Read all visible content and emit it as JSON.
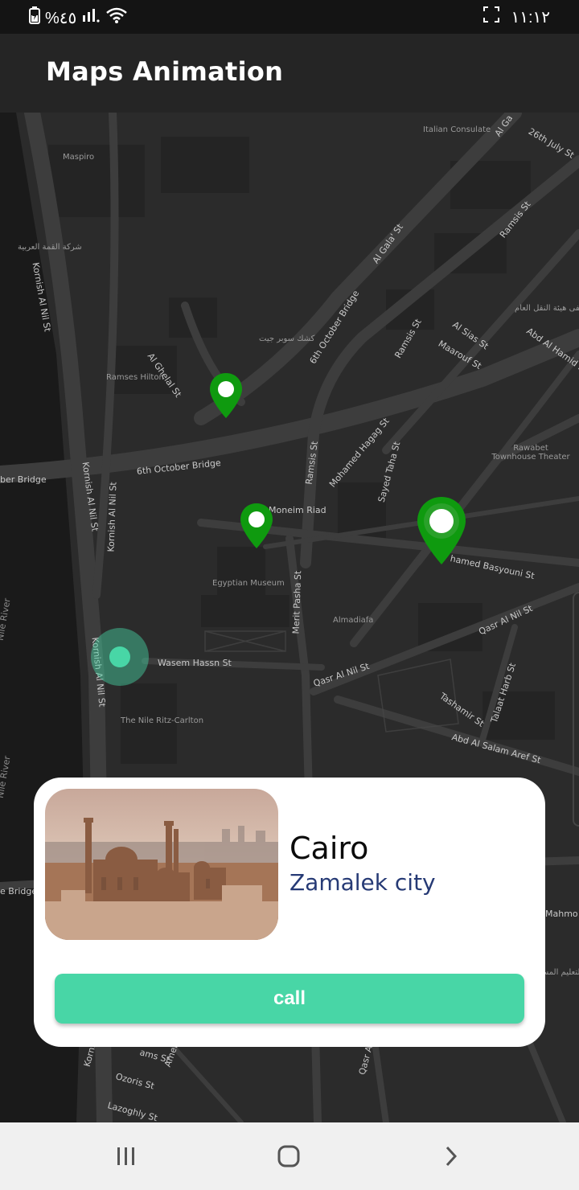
{
  "status_bar": {
    "battery_text": "%٤٥",
    "time": "١١:١٢"
  },
  "app_bar": {
    "title": "Maps Animation"
  },
  "map": {
    "labels": {
      "maspiro": "Maspiro",
      "italian_consulate": "Italian Consulate",
      "qimma_ar": "شركة القمة العربية",
      "ramses_hilton": "Ramses Hilton",
      "canal_suez_ar": "كشك سوبر جيت",
      "egyptian_museum": "Egyptian Museum",
      "almadiafa": "Almadiafa",
      "nile_ritz": "The Nile Ritz-Carlton",
      "rawabet": "Rawabet Townhouse Theater",
      "hayaa_ar": "شفى هيئة النقل العام",
      "taleem_ar": "التعليم المس"
    },
    "roads": {
      "oct6_bridge_a": "6th October Bridge",
      "oct6_bridge_b": "6th October Bridge",
      "oct6_bridge_c": "ber Bridge",
      "al_gala": "Al Gala' St",
      "al_gala_top": "Al Ga",
      "july26": "26th July St",
      "ramsis_top": "Ramsis St",
      "ramsis_mid": "Ramsis St",
      "ramsis_low": "Ramsis St",
      "kornish_1": "Kornish Al Nil St",
      "kornish_2": "Kornish Al Nil St",
      "kornish_3": "Kornish Al Nil St",
      "kornish_4": "Kornish Al Nil St",
      "al_ghelal": "Al Ghelal St",
      "moneim": "Moneim Riad",
      "merit": "Merit Pasha St",
      "wasem": "Wasem Hassn St",
      "basyouni": "hamed Basyouni St",
      "qasr_1": "Qasr Al Nil St",
      "qasr_2": "Qasr Al Nil St",
      "sayed_taha": "Sayed Taha St",
      "haggag": "Mohamed Hagag St",
      "al_sias": "Al Sias St",
      "maarouf": "Maarouf St",
      "abd_hamid": "Abd Al Hamid Sa",
      "tashamir": "Tashamir St",
      "talaat": "Talaat Harb St",
      "abd_salam": "Abd Al Salam Aref St",
      "nile_river_1": "Nile River",
      "nile_river_2": "Nile River",
      "bridge_left": "e Bridge",
      "mahmo": "Mahmo",
      "bottom_1": "ams St",
      "bottom_2": "Ozoris St",
      "bottom_3": "Lazoghly St",
      "bottom_4": "America",
      "bottom_5": "Kornish",
      "bottom_6": "Qasr Al"
    },
    "marker_color": "#0f9a0f",
    "user_location_color": "#48d6a6"
  },
  "card": {
    "title": "Cairo",
    "subtitle": "Zamalek city",
    "call_label": "call",
    "accent": "#48d6a6",
    "subtitle_color": "#263a75"
  },
  "nav_bar": {
    "icons": [
      "recent-apps-icon",
      "home-icon",
      "back-icon"
    ]
  }
}
